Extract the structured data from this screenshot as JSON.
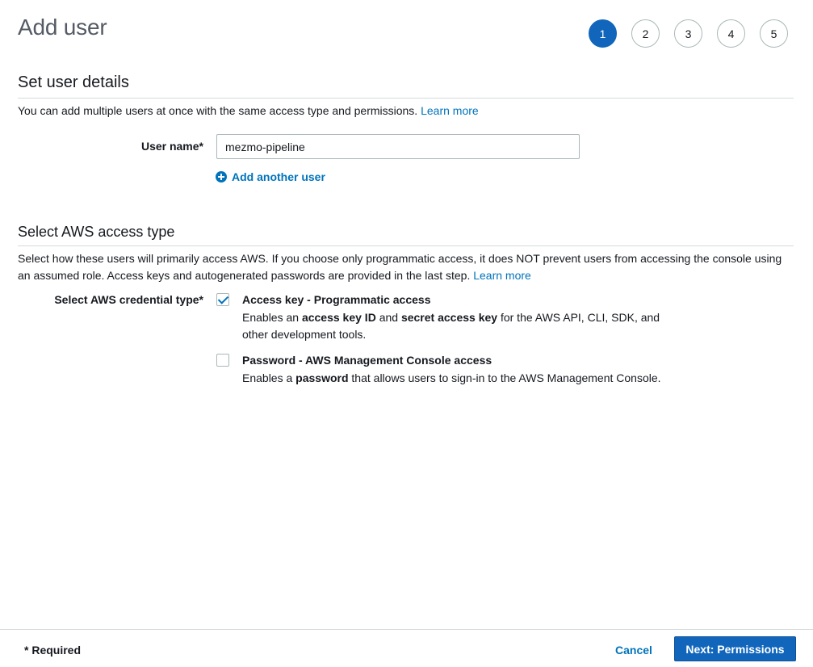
{
  "page": {
    "title": "Add user"
  },
  "steps": [
    "1",
    "2",
    "3",
    "4",
    "5"
  ],
  "details": {
    "title": "Set user details",
    "description": "You can add multiple users at once with the same access type and permissions.",
    "learn_more": "Learn more",
    "user_name_label": "User name*",
    "user_name_value": "mezmo-pipeline",
    "add_another_label": "Add another user"
  },
  "access": {
    "title": "Select AWS access type",
    "description": "Select how these users will primarily access AWS. If you choose only programmatic access, it does NOT prevent users from accessing the console using an assumed role. Access keys and autogenerated passwords are provided in the last step.",
    "learn_more": "Learn more",
    "credential_label": "Select AWS credential type*",
    "options": [
      {
        "title": "Access key - Programmatic access",
        "checked": true,
        "desc_parts": [
          "Enables an ",
          "access key ID",
          " and ",
          "secret access key",
          " for the AWS API, CLI, SDK, and other development tools."
        ]
      },
      {
        "title": "Password - AWS Management Console access",
        "checked": false,
        "desc_parts": [
          "Enables a ",
          "password",
          " that allows users to sign-in to the AWS Management Console."
        ]
      }
    ]
  },
  "footer": {
    "required": "* Required",
    "cancel": "Cancel",
    "next": "Next: Permissions"
  },
  "colors": {
    "primary": "#1166bb",
    "link": "#0073bb"
  }
}
